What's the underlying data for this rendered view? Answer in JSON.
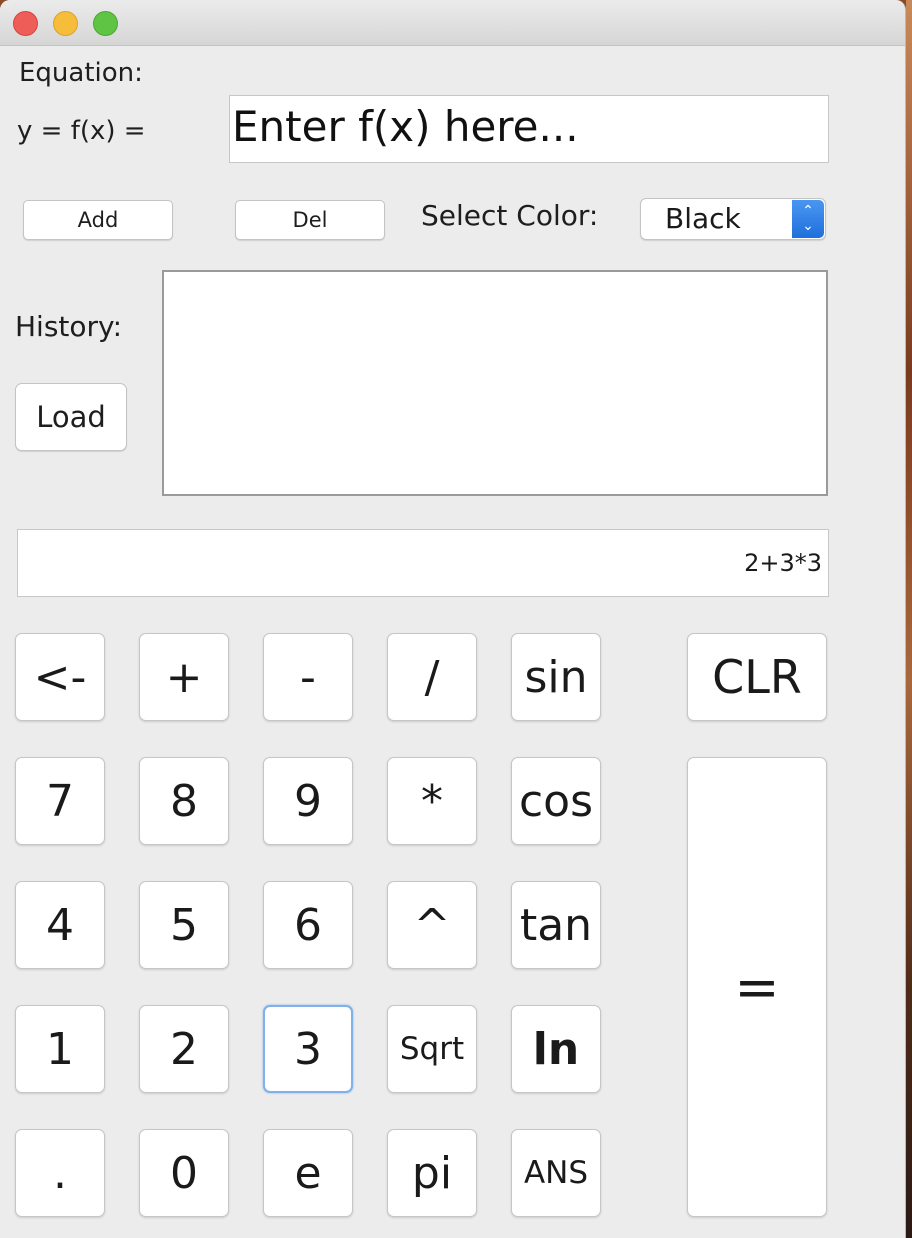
{
  "equation": {
    "label": "Equation:",
    "fx_label": "y = f(x) =",
    "input_value": "Enter f(x) here..."
  },
  "controls": {
    "add_label": "Add",
    "del_label": "Del",
    "select_color_label": "Select Color:",
    "color_selected": "Black"
  },
  "history": {
    "label": "History:",
    "load_label": "Load"
  },
  "display": {
    "value": "2+3*3"
  },
  "keypad": {
    "row1": [
      "<-",
      "+",
      "-",
      "/",
      "sin"
    ],
    "row2": [
      "7",
      "8",
      "9",
      "*",
      "cos"
    ],
    "row3": [
      "4",
      "5",
      "6",
      "^",
      "tan"
    ],
    "row4": [
      "1",
      "2",
      "3",
      "Sqrt",
      "ln"
    ],
    "row5": [
      ".",
      "0",
      "e",
      "pi",
      "ANS"
    ],
    "clear": "CLR",
    "equals": "="
  },
  "colors": {
    "window_bg": "#ececec",
    "select_accent": "#2a7ae2",
    "focus_ring": "#7fb1ea"
  }
}
